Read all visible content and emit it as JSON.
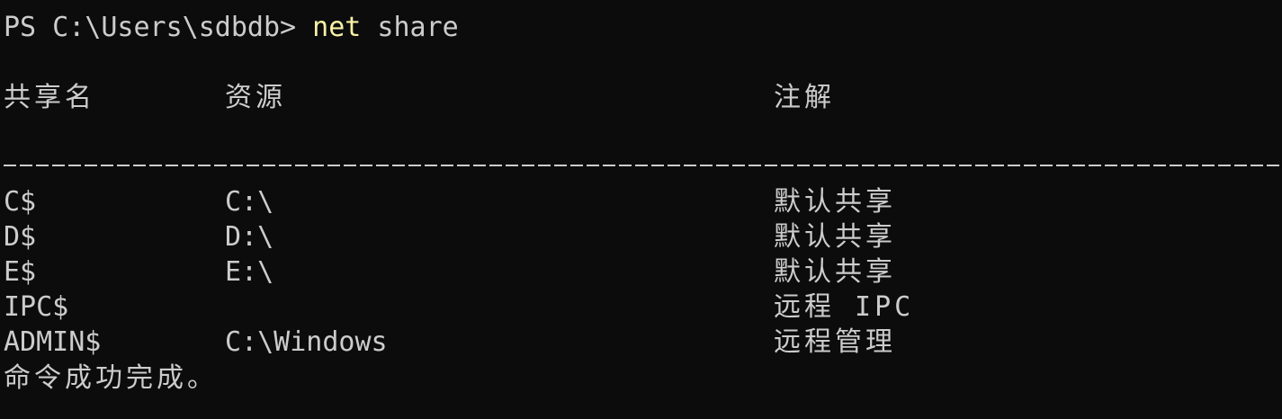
{
  "prompt": {
    "prefix": "PS C:\\Users\\sdbdb> ",
    "command": "net",
    "args": " share"
  },
  "table": {
    "headers": {
      "name": "共享名",
      "resource": "资源",
      "remark": "注解"
    },
    "rows": [
      {
        "name": "C$",
        "resource": "C:\\",
        "remark": "默认共享"
      },
      {
        "name": "D$",
        "resource": "D:\\",
        "remark": "默认共享"
      },
      {
        "name": "E$",
        "resource": "E:\\",
        "remark": "默认共享"
      },
      {
        "name": "IPC$",
        "resource": "",
        "remark": "远程 IPC"
      },
      {
        "name": "ADMIN$",
        "resource": "C:\\Windows",
        "remark": "远程管理"
      }
    ]
  },
  "status_message": "命令成功完成。",
  "colors": {
    "background": "#0c0c0c",
    "foreground": "#cccccc",
    "command_highlight": "#f9f1a5"
  }
}
